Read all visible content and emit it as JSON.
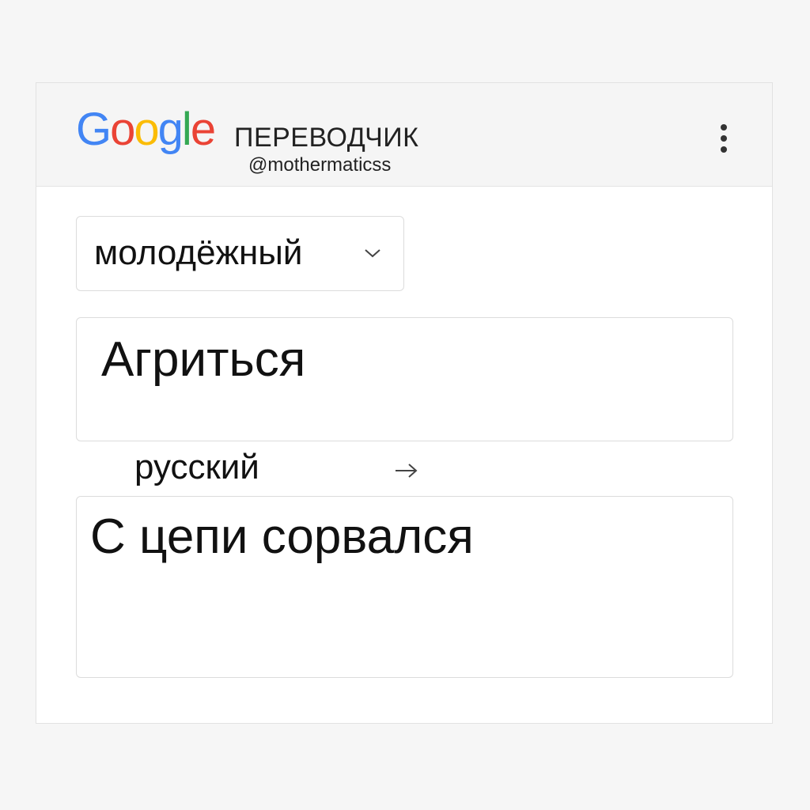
{
  "header": {
    "logo_letters": [
      {
        "char": "G",
        "color": "#4285F4"
      },
      {
        "char": "o",
        "color": "#EA4335"
      },
      {
        "char": "o",
        "color": "#FBBC05"
      },
      {
        "char": "g",
        "color": "#4285F4"
      },
      {
        "char": "l",
        "color": "#34A853"
      },
      {
        "char": "e",
        "color": "#EA4335"
      }
    ],
    "title": "ПЕРЕВОДЧИК",
    "handle": "@mothermaticss",
    "menu_icon": "more-vert-icon"
  },
  "source_language": {
    "selected": "молодёжный",
    "icon": "chevron-down-icon"
  },
  "source_text": "Агриться",
  "target_language": {
    "label": "русский",
    "icon": "arrow-right-icon"
  },
  "translation": "С цепи сорвался"
}
